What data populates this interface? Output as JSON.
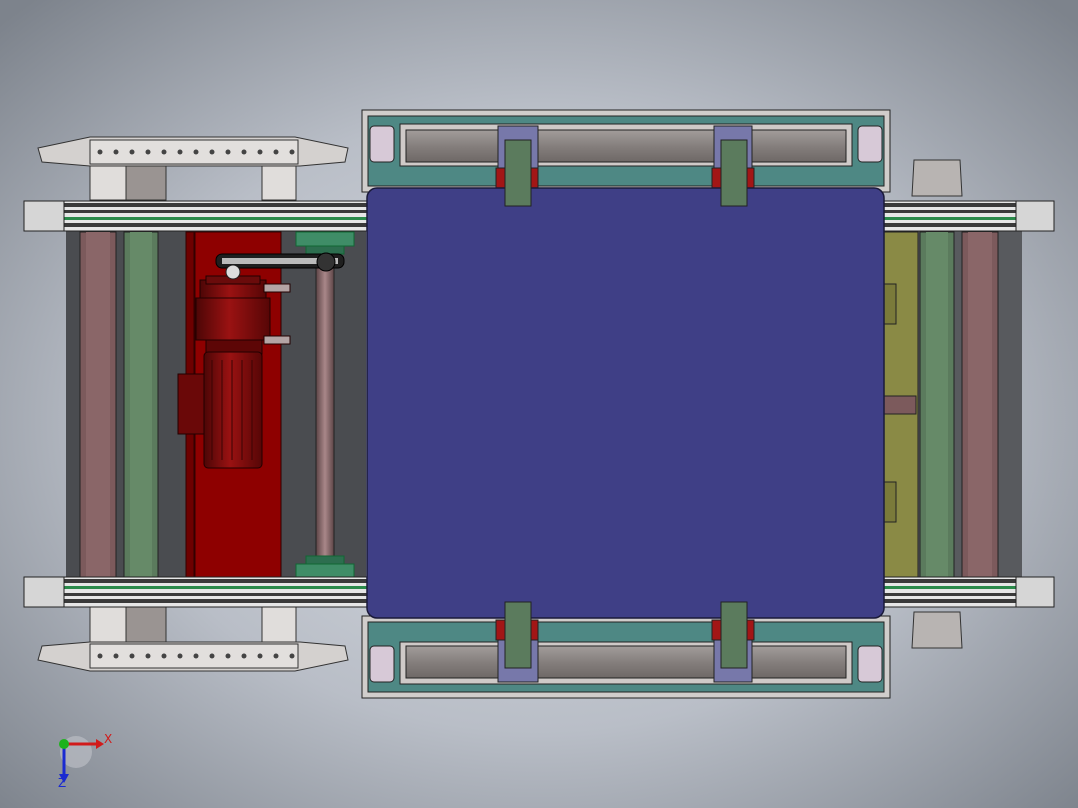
{
  "triad": {
    "x_label": "X",
    "z_label": "Z",
    "x_color": "#d11a1a",
    "y_color": "#1db31d",
    "z_color": "#1a2ad1"
  },
  "colors": {
    "background_light": "#c9ced6",
    "background_dark": "#7b8088",
    "pallet_plate": "#3f3f86",
    "motor_frame": "#8e0000",
    "motor": "#7a0b0b",
    "chain_rail": "#646b67",
    "green_beam": "#5b7b5d",
    "brown_beam": "#7c5a5c",
    "olive_panel": "#8a8a45",
    "roller_body": "#8a8583",
    "lift_frame": "#4e8884",
    "bracket_grey": "#c7c2c0"
  }
}
